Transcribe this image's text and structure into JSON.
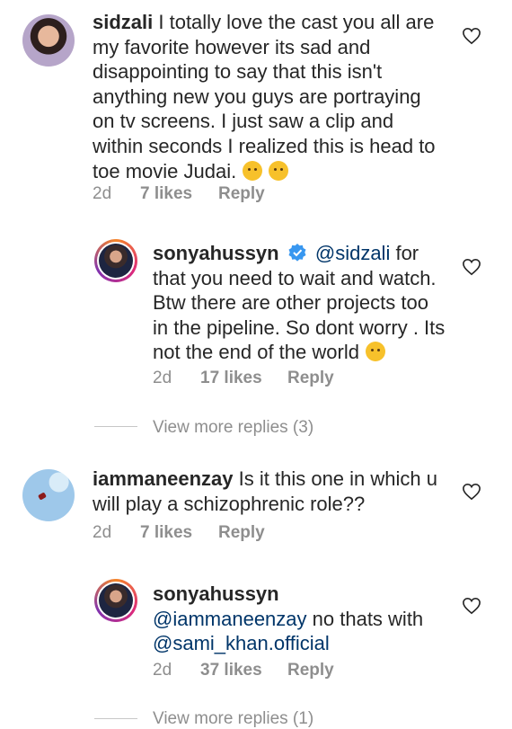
{
  "comments": [
    {
      "username": "sidzali",
      "text": "I totally love the cast you all are my favorite however its sad and disappointing to say that this isn't anything new you guys are portraying on tv screens. I just saw a clip and within seconds I realized this is head to toe movie Judai.",
      "time": "2d",
      "likes": "7 likes",
      "reply": "Reply"
    },
    {
      "username": "sonyahussyn",
      "mention": "@sidzali",
      "text": "for that you need to wait and watch. Btw there are other projects too in the pipeline. So dont worry . Its not the end of the world",
      "time": "2d",
      "likes": "17 likes",
      "reply": "Reply"
    },
    {
      "view_more": "View more replies (3)"
    },
    {
      "username": "iammaneenzay",
      "text": "Is it this one in which u will play a schizophrenic role??",
      "time": "2d",
      "likes": "7 likes",
      "reply": "Reply"
    },
    {
      "username": "sonyahussyn",
      "mention1": "@iammaneenzay",
      "text": "no thats with",
      "mention2": "@sami_khan.official",
      "time": "2d",
      "likes": "37 likes",
      "reply": "Reply"
    },
    {
      "view_more": "View more replies (1)"
    }
  ],
  "colors": {
    "text": "#262626",
    "muted": "#8e8e8e",
    "mention": "#003569",
    "verified": "#3897f0"
  }
}
